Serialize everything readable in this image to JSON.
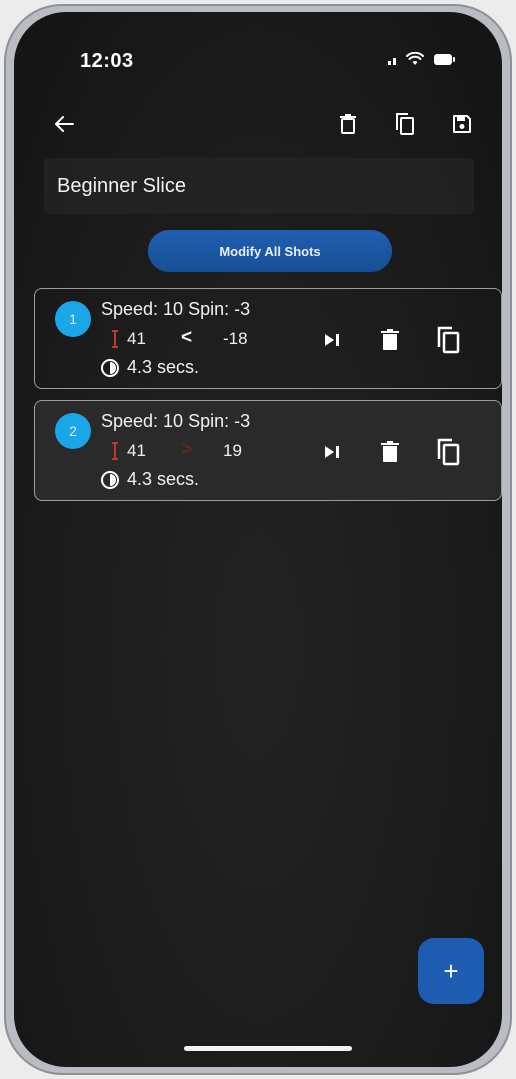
{
  "status_bar": {
    "time": "12:03"
  },
  "header": {
    "title": "Beginner Slice"
  },
  "modify_all_label": "Modify All Shots",
  "shots": [
    {
      "number": "1",
      "speed_spin": "Speed: 10 Spin: -3",
      "value_a": "41",
      "arrow": "<",
      "value_b": "-18",
      "duration": "4.3 secs."
    },
    {
      "number": "2",
      "speed_spin": "Speed: 10 Spin: -3",
      "value_a": "41",
      "arrow": ">",
      "value_b": "19",
      "duration": "4.3 secs."
    }
  ],
  "fab_label": "+",
  "colors": {
    "accent": "#1d5cb0",
    "number_badge": "#1ba6e8",
    "pin_red": "#c0392b"
  },
  "icons": [
    "back-arrow-icon",
    "trash-icon",
    "copy-icon",
    "save-icon",
    "skip-next-icon",
    "timer-icon",
    "height-pin-icon",
    "plus-icon"
  ]
}
